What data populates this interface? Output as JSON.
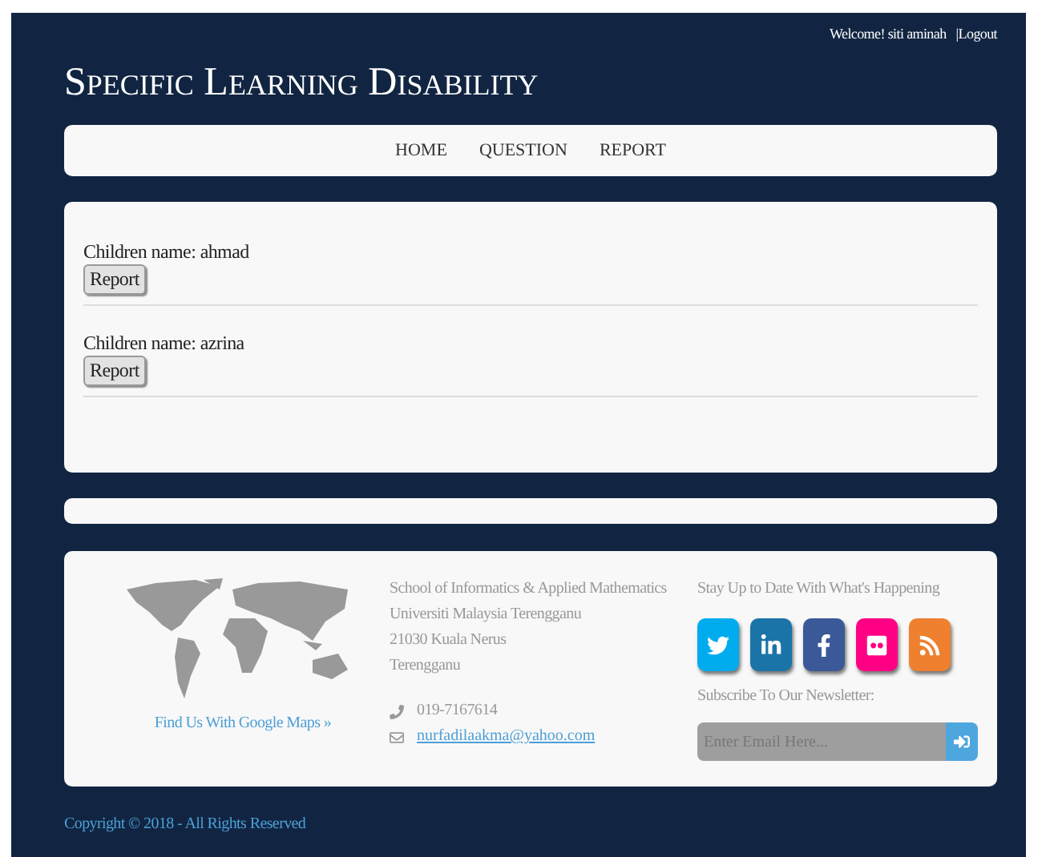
{
  "topbar": {
    "welcome": "Welcome! siti aminah",
    "logout": "|Logout"
  },
  "site_title": "Specific Learning Disability",
  "nav": [
    {
      "label": "HOME"
    },
    {
      "label": "QUESTION"
    },
    {
      "label": "REPORT"
    }
  ],
  "children": [
    {
      "label": "Children name: ahmad",
      "button": "Report"
    },
    {
      "label": "Children name: azrina",
      "button": "Report"
    }
  ],
  "footer": {
    "map_link": "Find Us With Google Maps »",
    "address": [
      "School of Informatics & Applied Mathematics",
      "Universiti Malaysia Terengganu",
      "21030 Kuala Nerus",
      "Terengganu"
    ],
    "phone": "019-7167614",
    "email": "nurfadilaakma@yahoo.com",
    "social_heading": "Stay Up to Date With What's Happening",
    "social": [
      {
        "kind": "twitter",
        "color": "#00acee"
      },
      {
        "kind": "linkedin",
        "color": "#1a74a8"
      },
      {
        "kind": "facebook",
        "color": "#3b5998"
      },
      {
        "kind": "flickr",
        "color": "#ff0084"
      },
      {
        "kind": "rss",
        "color": "#ee802f"
      }
    ],
    "newsletter_heading": "Subscribe To Our Newsletter:",
    "newsletter_placeholder": "Enter Email Here..."
  },
  "copyright": "Copyright © 2018 - All Rights Reserved"
}
